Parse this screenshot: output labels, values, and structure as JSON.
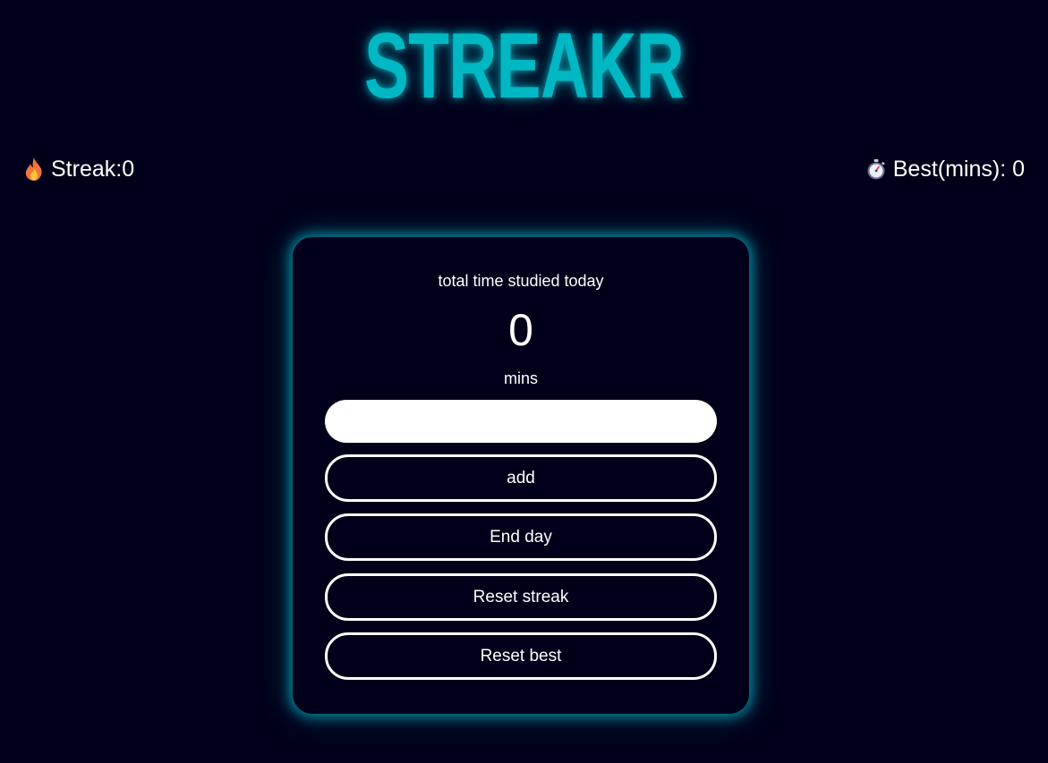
{
  "header": {
    "logo": "STREAKR"
  },
  "stats": {
    "streak": {
      "icon": "fire-icon",
      "text": "Streak:0"
    },
    "best": {
      "icon": "stopwatch-icon",
      "text": "Best(mins): 0"
    }
  },
  "card": {
    "caption": "total time studied today",
    "total_minutes": "0",
    "unit": "mins",
    "input": {
      "value": "",
      "placeholder": ""
    },
    "buttons": {
      "add": "add",
      "end_day": "End day",
      "reset_streak": "Reset streak",
      "reset_best": "Reset best"
    }
  },
  "colors": {
    "background": "#00001a",
    "accent": "#00b8c4",
    "text": "#ffffff",
    "glow": "#00afbe"
  }
}
